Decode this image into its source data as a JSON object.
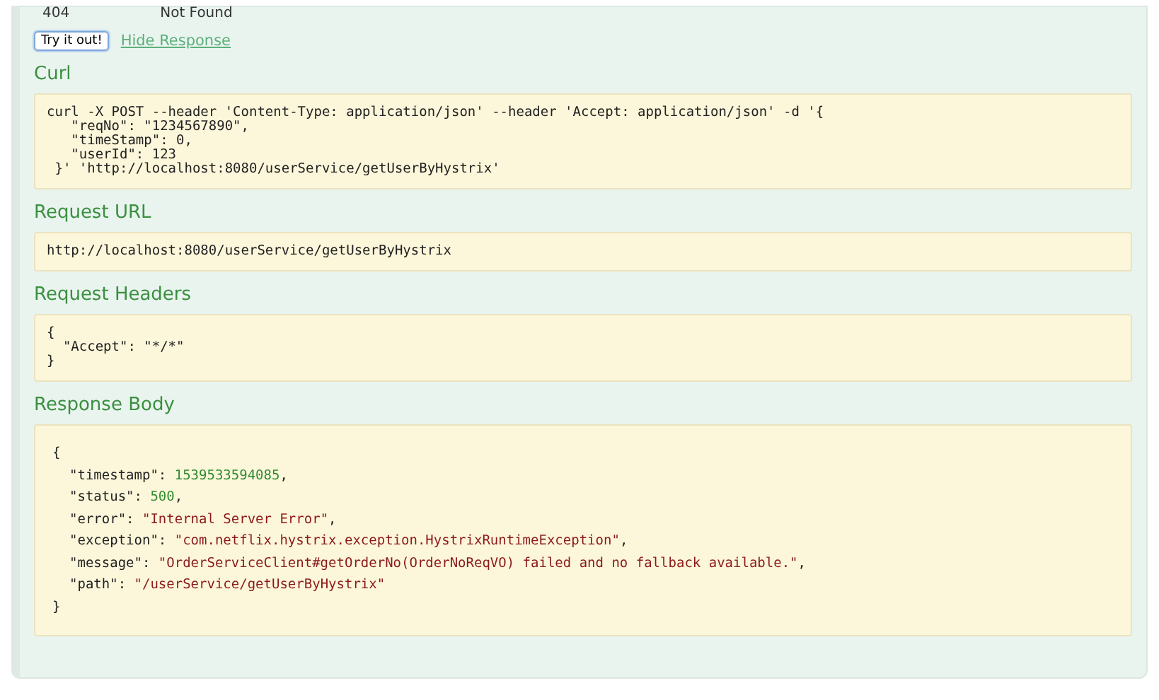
{
  "response_code": {
    "code": "404",
    "reason": "Not Found"
  },
  "try_button": {
    "label": "Try it out!"
  },
  "hide_link": {
    "label": "Hide Response"
  },
  "sections": [
    {
      "title": "Curl",
      "kind": "pre",
      "text": "curl -X POST --header 'Content-Type: application/json' --header 'Accept: application/json' -d '{\n   \"reqNo\": \"1234567890\",\n   \"timeStamp\": 0,\n   \"userId\": 123\n }' 'http://localhost:8080/userService/getUserByHystrix'"
    },
    {
      "title": "Request URL",
      "kind": "pre",
      "text": "http://localhost:8080/userService/getUserByHystrix"
    },
    {
      "title": "Request Headers",
      "kind": "pre",
      "text": "{\n  \"Accept\": \"*/*\"\n}"
    },
    {
      "title": "Response Body",
      "kind": "json",
      "open": "{",
      "close": "}",
      "fields": [
        {
          "key": "\"timestamp\":",
          "value": "1539533594085",
          "kind": "number",
          "suffix": ","
        },
        {
          "key": "\"status\":",
          "value": "500",
          "kind": "number",
          "suffix": ","
        },
        {
          "key": "\"error\":",
          "value": "\"Internal Server Error\"",
          "kind": "string",
          "suffix": ","
        },
        {
          "key": "\"exception\":",
          "value": "\"com.netflix.hystrix.exception.HystrixRuntimeException\"",
          "kind": "string",
          "suffix": ","
        },
        {
          "key": "\"message\":",
          "value": "\"OrderServiceClient#getOrderNo(OrderNoReqVO) failed and no fallback available.\"",
          "kind": "string",
          "suffix": ","
        },
        {
          "key": "\"path\":",
          "value": "\"/userService/getUserByHystrix\"",
          "kind": "string"
        }
      ]
    }
  ]
}
